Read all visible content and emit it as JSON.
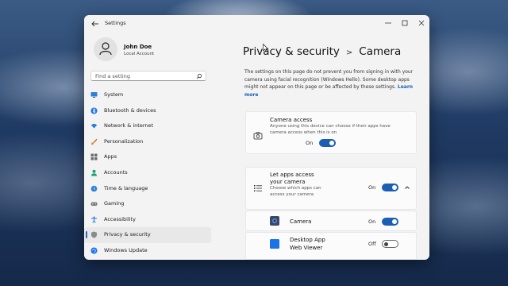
{
  "window": {
    "title": "Settings"
  },
  "user": {
    "name": "John Doe",
    "account_type": "Local Account"
  },
  "search": {
    "placeholder": "Find a setting"
  },
  "sidebar": {
    "items": [
      {
        "label": "System",
        "icon": "monitor-icon"
      },
      {
        "label": "Bluetooth & devices",
        "icon": "bluetooth-icon"
      },
      {
        "label": "Network & internet",
        "icon": "wifi-icon"
      },
      {
        "label": "Personalization",
        "icon": "brush-icon"
      },
      {
        "label": "Apps",
        "icon": "apps-icon"
      },
      {
        "label": "Accounts",
        "icon": "person-icon"
      },
      {
        "label": "Time & language",
        "icon": "globe-clock-icon"
      },
      {
        "label": "Gaming",
        "icon": "gamepad-icon"
      },
      {
        "label": "Accessibility",
        "icon": "accessibility-icon"
      },
      {
        "label": "Privacy & security",
        "icon": "shield-icon",
        "active": true
      },
      {
        "label": "Windows Update",
        "icon": "update-icon"
      }
    ]
  },
  "main": {
    "breadcrumb_parent": "Privacy & security",
    "breadcrumb_separator": ">",
    "breadcrumb_current": "Camera",
    "description": "The settings on this page do not prevent you from signing in with your camera using facial recognition (Windows Hello). Some desktop apps might not appear on this page or be affected by these settings.",
    "learn_more": "Learn more",
    "camera_access": {
      "title": "Camera access",
      "subtitle": "Anyone using this device can choose if their apps have camera access when this is on",
      "state_label": "On",
      "on": true
    },
    "let_apps": {
      "title": "Let apps access your camera",
      "subtitle": "Choose which apps can access your camera",
      "state_label": "On",
      "on": true,
      "expanded": true
    },
    "apps": [
      {
        "name": "Camera",
        "state_label": "On",
        "on": true
      },
      {
        "name": "Desktop App Web Viewer",
        "state_label": "Off",
        "on": false
      }
    ]
  },
  "colors": {
    "accent": "#1a5fb4",
    "window_bg": "#f3f3f3"
  }
}
